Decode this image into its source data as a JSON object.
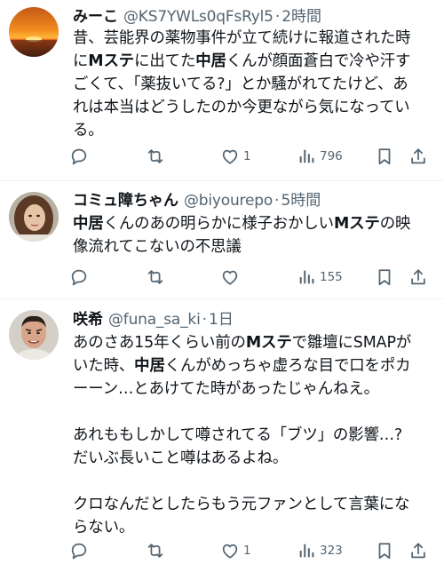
{
  "tweets": [
    {
      "name": "みーこ",
      "handle": "@KS7YWLs0qFsRyl5",
      "dot": "·",
      "time": "2時間",
      "avatar": "sunset-avatar",
      "lines": [
        [
          {
            "t": "昔、芸能界の薬物事件が立て続けに報道された時",
            "b": false
          }
        ],
        [
          {
            "t": "に",
            "b": false
          },
          {
            "t": "Mステ",
            "b": true
          },
          {
            "t": "に出てた",
            "b": false
          },
          {
            "t": "中居",
            "b": true
          },
          {
            "t": "くんが顔面蒼白で冷や汗す",
            "b": false
          }
        ],
        [
          {
            "t": "ごくて、「薬抜いてる?」とか騒がれてたけど、あ",
            "b": false
          }
        ],
        [
          {
            "t": "れは本当はどうしたのか今更ながら気になってい",
            "b": false
          }
        ],
        [
          {
            "t": "る。",
            "b": false
          }
        ]
      ],
      "stats": {
        "replies": "",
        "reposts": "",
        "likes": "1",
        "views": "796"
      }
    },
    {
      "name": "コミュ障ちゃん",
      "handle": "@biyourepo",
      "dot": "·",
      "time": "5時間",
      "avatar": "woman-avatar",
      "lines": [
        [
          {
            "t": "中居",
            "b": true
          },
          {
            "t": "くんのあの明らかに様子おかしい",
            "b": false
          },
          {
            "t": "Mステ",
            "b": true
          },
          {
            "t": "の映",
            "b": false
          }
        ],
        [
          {
            "t": "像流れてこないの不思議",
            "b": false
          }
        ]
      ],
      "stats": {
        "replies": "",
        "reposts": "",
        "likes": "",
        "views": "155"
      }
    },
    {
      "name": "咲希",
      "handle": "@funa_sa_ki",
      "dot": "·",
      "time": "1日",
      "avatar": "man-avatar",
      "lines": [
        [
          {
            "t": "あのさあ15年くらい前の",
            "b": false
          },
          {
            "t": "Mステ",
            "b": true
          },
          {
            "t": "で雛壇にSMAPが",
            "b": false
          }
        ],
        [
          {
            "t": "いた時、",
            "b": false
          },
          {
            "t": "中居",
            "b": true
          },
          {
            "t": "くんがめっちゃ虚ろな目で口をポカ",
            "b": false
          }
        ],
        [
          {
            "t": "ーーン…とあけてた時があったじゃんねえ。",
            "b": false
          }
        ],
        [],
        [
          {
            "t": "あれももしかして噂されてる「ブツ」の影響…?",
            "b": false
          }
        ],
        [
          {
            "t": "だいぶ長いこと噂はあるよね。",
            "b": false
          }
        ],
        [],
        [
          {
            "t": "クロなんだとしたらもう元ファンとして言葉にな",
            "b": false
          }
        ],
        [
          {
            "t": "らない。",
            "b": false
          }
        ]
      ],
      "stats": {
        "replies": "",
        "reposts": "",
        "likes": "1",
        "views": "323"
      }
    }
  ],
  "icons": [
    "reply-icon",
    "repost-icon",
    "like-icon",
    "views-icon",
    "bookmark-icon",
    "share-icon"
  ],
  "colors": {
    "text": "#0f1419",
    "secondary": "#536471",
    "divider": "#eff3f4"
  }
}
